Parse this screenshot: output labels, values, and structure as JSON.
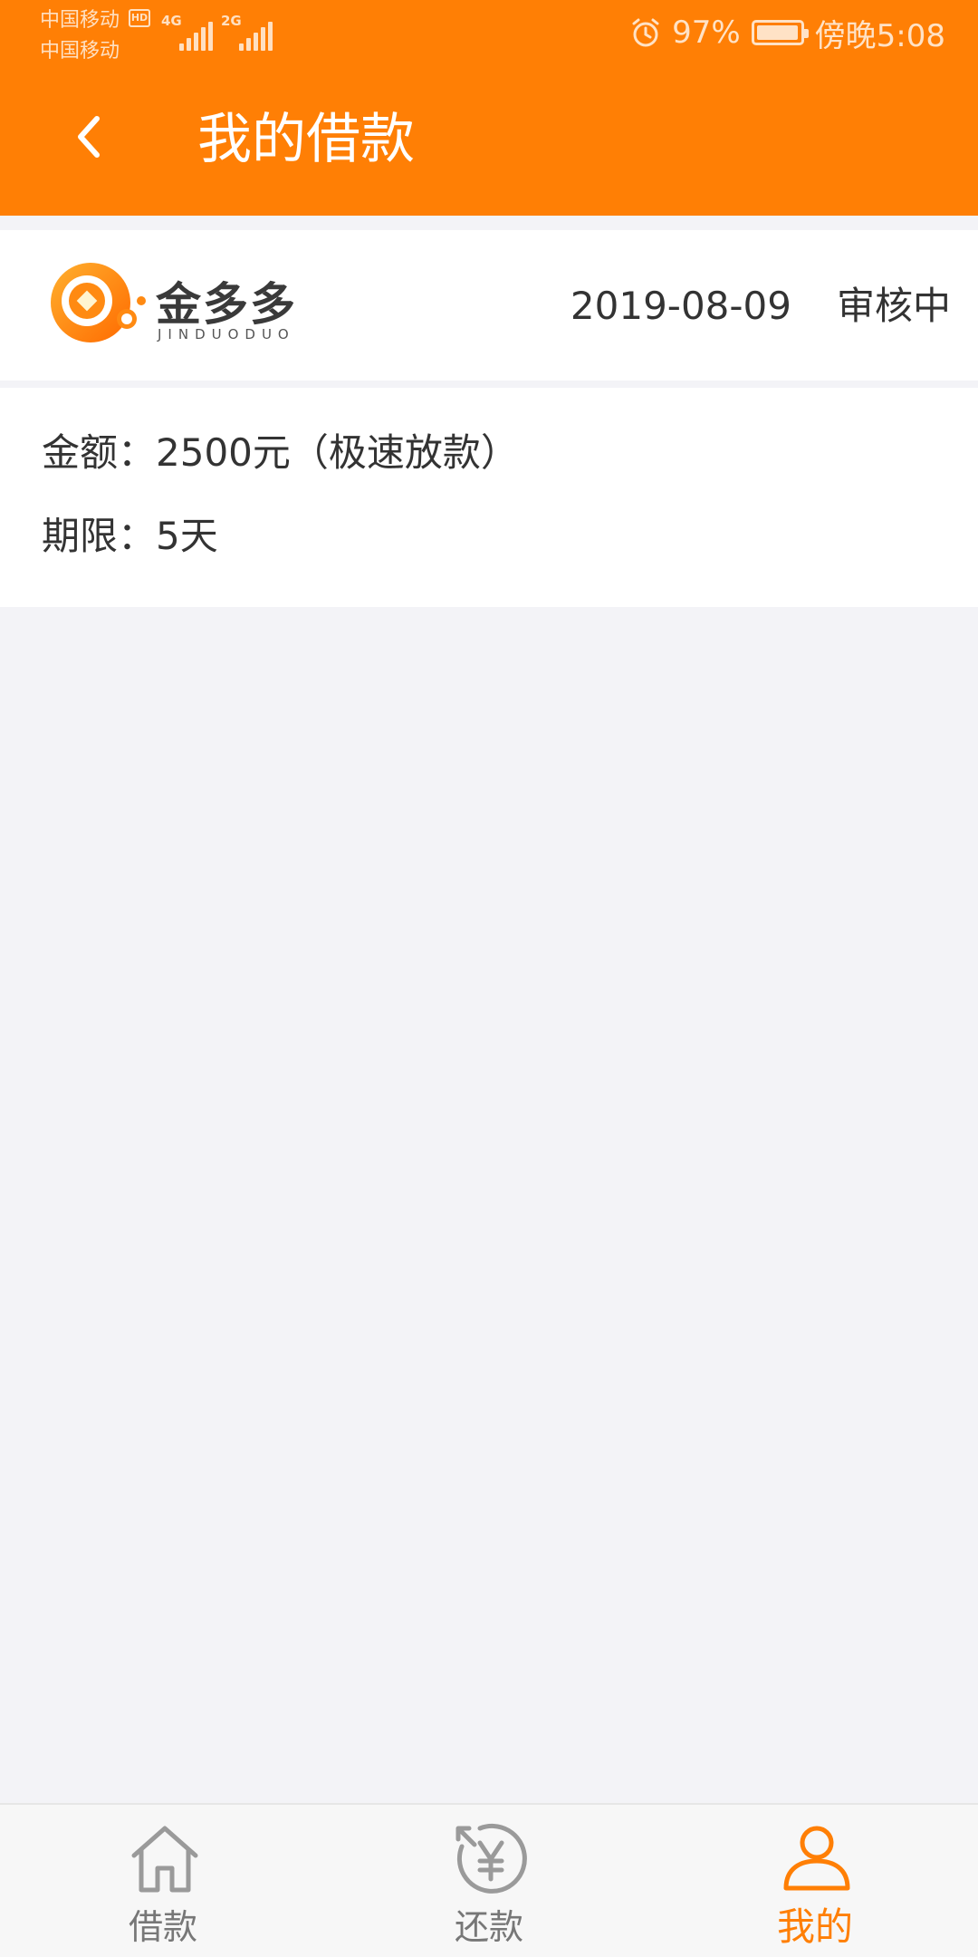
{
  "status_bar": {
    "carrier_1": "中国移动",
    "carrier_2": "中国移动",
    "hd_badge": "HD",
    "sim1_network": "4G",
    "sim2_network": "2G",
    "battery_percent": "97%",
    "battery_level": 0.97,
    "time": "傍晚5:08"
  },
  "nav": {
    "title": "我的借款",
    "back_icon": "chevron-left-icon"
  },
  "loan": {
    "lender_name_cn": "金多多",
    "lender_name_en": "JINDUODUO",
    "date": "2019-08-09",
    "status": "审核中",
    "amount_line": "金额：2500元（极速放款）",
    "term_line": "期限：5天"
  },
  "tabs": [
    {
      "label": "借款",
      "icon": "home-icon",
      "active": false
    },
    {
      "label": "还款",
      "icon": "repay-yen-icon",
      "active": false
    },
    {
      "label": "我的",
      "icon": "user-icon",
      "active": true
    }
  ],
  "colors": {
    "brand": "#ff7f05",
    "background": "#f3f3f7",
    "text": "#333333",
    "tab_inactive": "#777777"
  }
}
